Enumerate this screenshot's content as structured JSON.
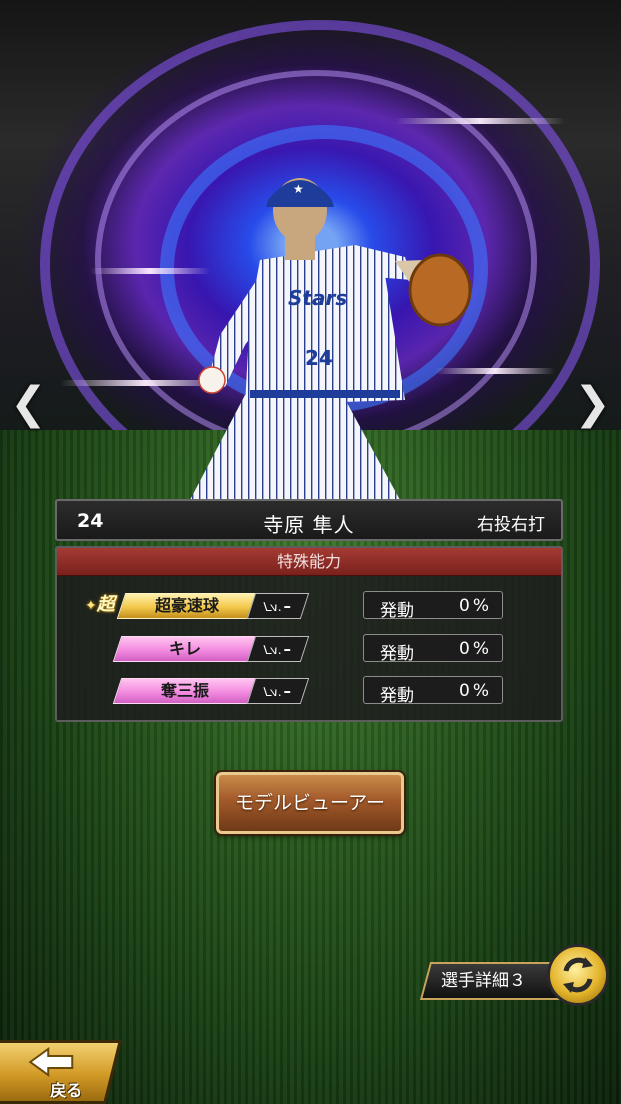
{
  "player": {
    "number": "24",
    "name": "寺原 隼人",
    "handedness": "右投右打",
    "jersey_text": "24"
  },
  "nav": {
    "prev_glyph": "❮",
    "next_glyph": "❯"
  },
  "abilities": {
    "header": "特殊能力",
    "super_badge": "超",
    "level_prefix": "Lv.",
    "level_value": "–",
    "items": [
      {
        "name": "超豪速球",
        "tier": "gold",
        "activation_label": "発動",
        "activation_rate": "0%"
      },
      {
        "name": "キレ",
        "tier": "pink",
        "activation_label": "発動",
        "activation_rate": "0%"
      },
      {
        "name": "奪三振",
        "tier": "pink",
        "activation_label": "発動",
        "activation_rate": "0%"
      }
    ]
  },
  "buttons": {
    "model_viewer": "モデルビューアー",
    "player_detail": "選手詳細３",
    "back": "戻る"
  },
  "colors": {
    "ability_header": "#8f2a24",
    "gold_skill": "#f2c84a",
    "pink_skill": "#f38be0",
    "button_brown": "#a2592a"
  }
}
